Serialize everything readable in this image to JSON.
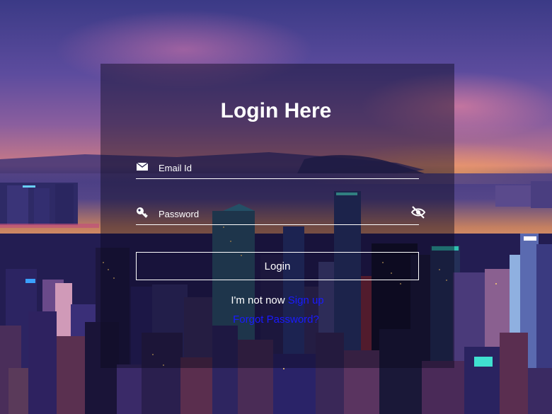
{
  "form": {
    "title": "Login Here",
    "email_placeholder": "Email Id",
    "password_placeholder": "Password",
    "login_label": "Login",
    "signup_prompt": "I'm not now ",
    "signup_link": "Sign up",
    "forgot_link": "Forgot Password?"
  },
  "icons": {
    "email": "envelope-icon",
    "password": "key-icon",
    "toggle_visibility": "eye-slash-icon"
  },
  "colors": {
    "text": "#ffffff",
    "link": "#1a1aff",
    "panel_overlay": "rgba(10,8,30,0.45)"
  }
}
